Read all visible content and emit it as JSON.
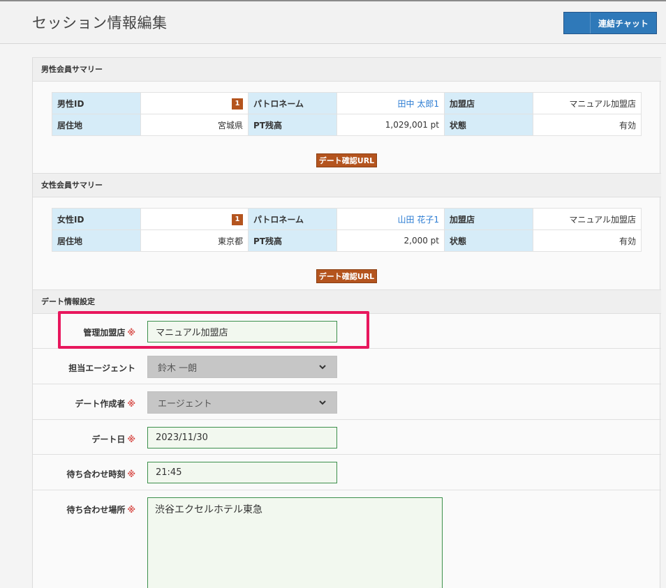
{
  "page": {
    "title": "セッション情報編集",
    "chat_button": "連結チャット"
  },
  "male_summary": {
    "heading": "男性会員サマリー",
    "id_label": "男性ID",
    "id_value": "1",
    "patron_label": "パトロネーム",
    "patron_value": "田中 太郎1",
    "store_label": "加盟店",
    "store_value": "マニュアル加盟店",
    "residence_label": "居住地",
    "residence_value": "宮城県",
    "pt_label": "PT残高",
    "pt_value": "1,029,001 pt",
    "status_label": "状態",
    "status_value": "有効",
    "url_button": "デート確認URL"
  },
  "female_summary": {
    "heading": "女性会員サマリー",
    "id_label": "女性ID",
    "id_value": "1",
    "patron_label": "パトロネーム",
    "patron_value": "山田 花子1",
    "store_label": "加盟店",
    "store_value": "マニュアル加盟店",
    "residence_label": "居住地",
    "residence_value": "東京都",
    "pt_label": "PT残高",
    "pt_value": "2,000 pt",
    "status_label": "状態",
    "status_value": "有効",
    "url_button": "デート確認URL"
  },
  "date_settings": {
    "heading": "デート情報設定",
    "required_mark": "※",
    "store": {
      "label": "管理加盟店",
      "value": "マニュアル加盟店"
    },
    "agent": {
      "label": "担当エージェント",
      "value": "鈴木 一朗"
    },
    "creator": {
      "label": "デート作成者",
      "value": "エージェント"
    },
    "date": {
      "label": "デート日",
      "value": "2023/11/30"
    },
    "time": {
      "label": "待ち合わせ時刻",
      "value": "21:45"
    },
    "place": {
      "label": "待ち合わせ場所",
      "value": "渋谷エクセルホテル東急"
    }
  },
  "colors": {
    "accent_blue": "#2f79b9",
    "label_bg": "#d6ecf8",
    "badge_brown": "#b4541e",
    "input_border_green": "#3c8f4b",
    "highlight_pink": "#e8175d",
    "link_blue": "#2a7bd2"
  },
  "icons": {
    "select_arrow": "chevron-down-icon",
    "resize": "resize-grip-icon"
  }
}
